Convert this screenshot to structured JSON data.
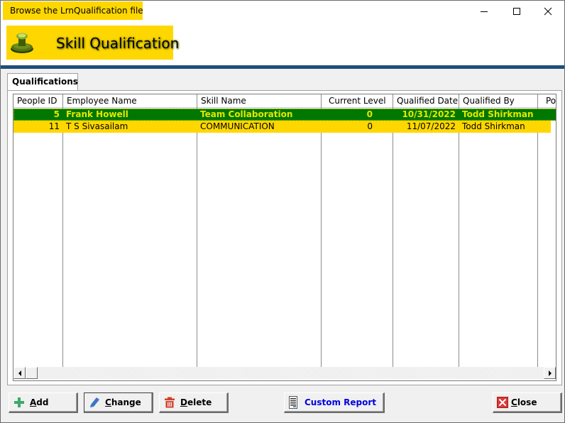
{
  "window": {
    "title": "Browse the LrnQualification file",
    "controls": [
      "minimize",
      "maximize",
      "close"
    ]
  },
  "header": {
    "title": "Skill Qualification",
    "icon": "rubber-stamp-icon"
  },
  "tabs": [
    {
      "label": "Qualifications",
      "active": true
    }
  ],
  "grid": {
    "columns": [
      {
        "label": "People ID",
        "align": "right"
      },
      {
        "label": "Employee Name",
        "align": "left"
      },
      {
        "label": "Skill Name",
        "align": "left"
      },
      {
        "label": "Current Level",
        "align": "right"
      },
      {
        "label": "Qualified Date",
        "align": "right"
      },
      {
        "label": "Qualified By",
        "align": "left"
      },
      {
        "label": "Po",
        "align": "left"
      }
    ],
    "rows": [
      {
        "people_id": "5",
        "employee_name": "Frank Howell",
        "skill_name": "Team Collaboration",
        "current_level": "0",
        "qualified_date": "10/31/2022",
        "qualified_by": "Todd Shirkman",
        "po": "",
        "selected": true
      },
      {
        "people_id": "11",
        "employee_name": "T S Sivasailam",
        "skill_name": "COMMUNICATION",
        "current_level": "0",
        "qualified_date": "11/07/2022",
        "qualified_by": "Todd Shirkman",
        "po": "",
        "selected": false
      }
    ],
    "colors": {
      "selected_bg": "#007800",
      "selected_fg": "#e6e600",
      "row_bg": "#ffd700"
    }
  },
  "buttons": {
    "add": {
      "hotkey": "A",
      "rest": "dd",
      "icon": "plus-icon"
    },
    "change": {
      "hotkey": "C",
      "rest": "hange",
      "icon": "pencil-icon"
    },
    "delete": {
      "hotkey": "D",
      "rest": "elete",
      "icon": "trash-icon"
    },
    "custom_report": {
      "label": "Custom Report",
      "icon": "report-document-icon"
    },
    "close": {
      "hotkey": "C",
      "rest": "lose",
      "icon": "close-x-icon"
    }
  },
  "theme": {
    "accent_yellow": "#ffd700",
    "rule_blue": "#1f4e79"
  }
}
